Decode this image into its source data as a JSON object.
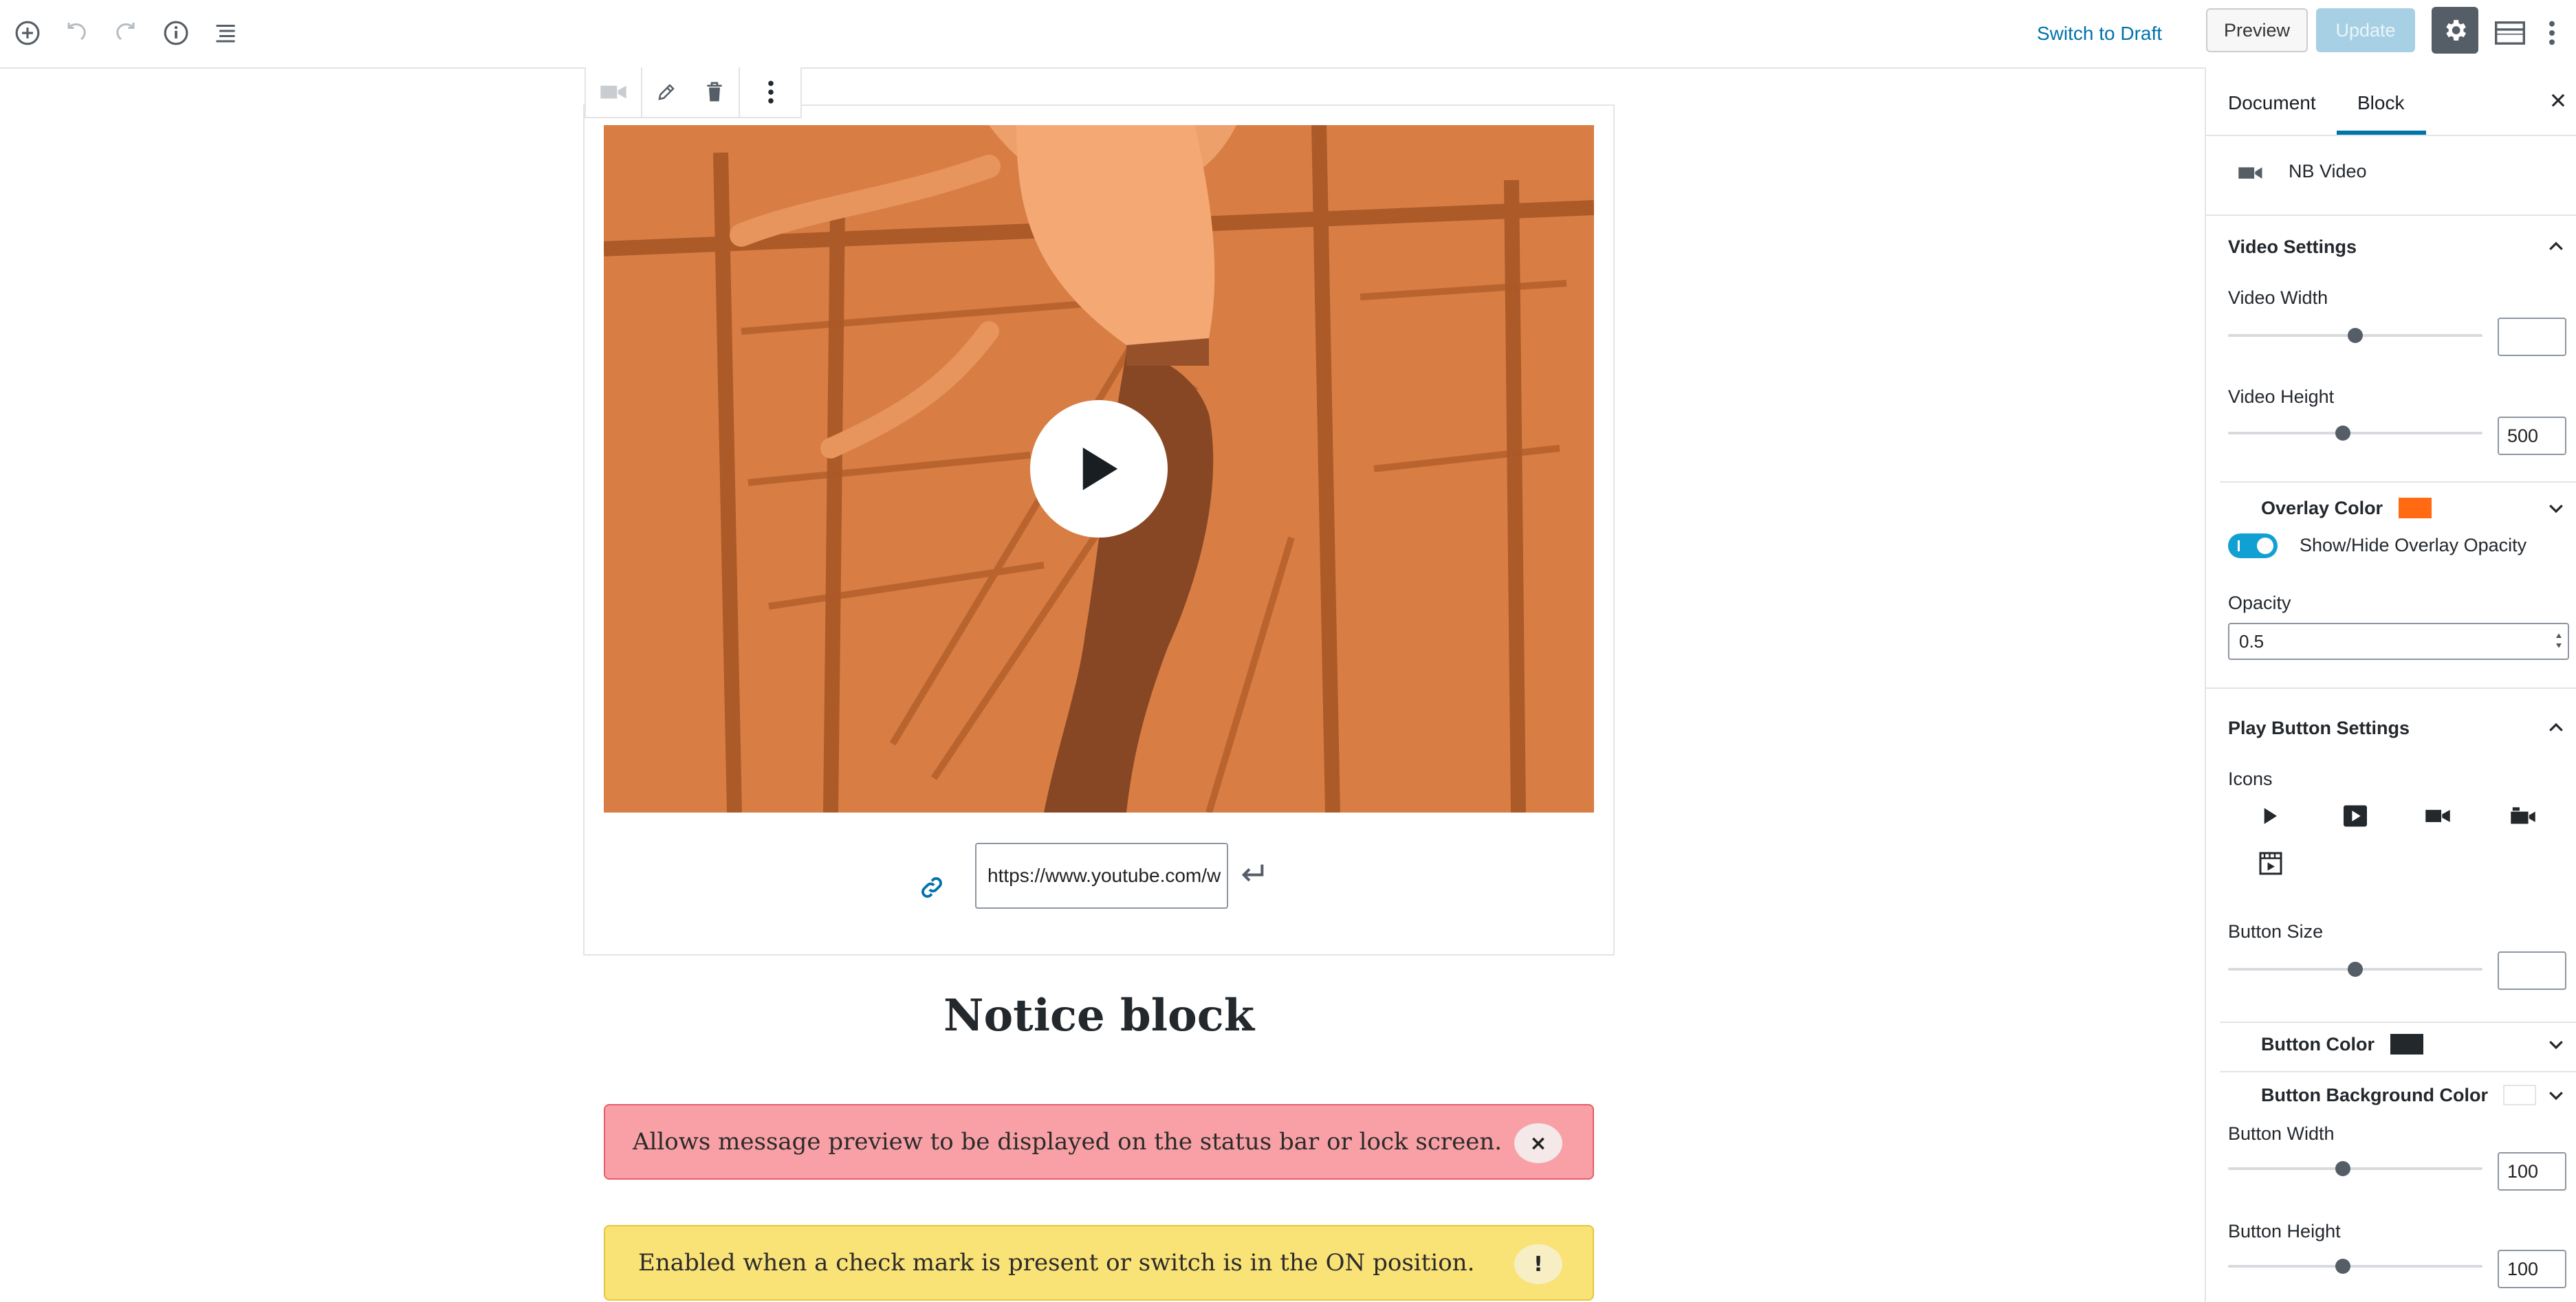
{
  "topbar": {
    "switch_to_draft": "Switch to Draft",
    "preview": "Preview",
    "update": "Update"
  },
  "editor": {
    "video_url": "https://www.youtube.com/w",
    "notice_heading": "Notice block",
    "notices": [
      {
        "text": "Allows message preview to be displayed on the status bar or lock screen.",
        "button": "×"
      },
      {
        "text": "Enabled when a check mark is present or switch is in the ON position.",
        "button": "!"
      }
    ]
  },
  "sidebar": {
    "tabs": {
      "document": "Document",
      "block": "Block"
    },
    "block_name": "NB Video",
    "video_settings": {
      "title": "Video Settings",
      "video_width_label": "Video Width",
      "video_width_value": "",
      "video_width_level": 0.5,
      "video_height_label": "Video Height",
      "video_height_value": "500",
      "video_height_level": 0.45,
      "overlay_color_label": "Overlay Color",
      "overlay_color": "#ff6a13",
      "overlay_toggle_label": "Show/Hide Overlay Opacity",
      "opacity_label": "Opacity",
      "opacity_value": "0.5"
    },
    "play_button_settings": {
      "title": "Play Button Settings",
      "icons_label": "Icons",
      "icons": [
        "play-icon",
        "play-box-icon",
        "video-camera-icon",
        "video-alt-icon",
        "film-icon"
      ],
      "button_size_label": "Button Size",
      "button_size_value": "",
      "button_size_level": 0.5,
      "button_color_label": "Button Color",
      "button_color": "#23282d",
      "button_bg_color_label": "Button Background Color",
      "button_bg_color": "#ffffff",
      "button_width_label": "Button Width",
      "button_width_value": "100",
      "button_width_level": 0.45,
      "button_height_label": "Button Height",
      "button_height_value": "100",
      "button_height_level": 0.45
    }
  },
  "colors": {
    "accent": "#0073aa",
    "overlay": "#ff6a13",
    "notice_red": "#f8a0a6",
    "notice_yellow": "#f9e276"
  }
}
